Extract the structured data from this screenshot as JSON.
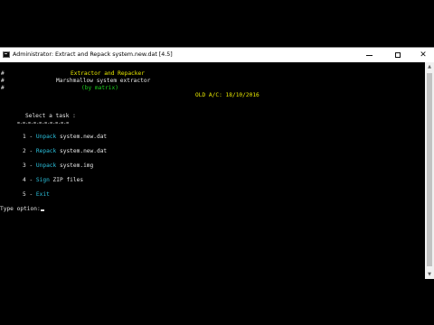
{
  "window": {
    "title": "Administrator:  Extract and Repack system.new.dat [4.5]",
    "icon": "cmd-icon"
  },
  "header": {
    "hash1": "#",
    "hash2": "#",
    "hash3": "#",
    "line1": "Extractor and Repacker",
    "line2": "Marshmallow system extractor",
    "line3": "(by matrix)",
    "old_ac": "OLD A/C: 18/10/2016"
  },
  "menu": {
    "heading": "Select a task :",
    "divider": "=-=-=-=-=-=-=-=-=-=",
    "items": [
      {
        "num": "1 - ",
        "action": "Unpack",
        "target": " system.new.dat"
      },
      {
        "num": "2 - ",
        "action": "Repack",
        "target": " system.new.dat"
      },
      {
        "num": "3 - ",
        "action": "Unpack",
        "target": " system.img"
      },
      {
        "num": "4 - ",
        "action": "Sign",
        "target": " ZIP files"
      },
      {
        "num": "5 - ",
        "action": "Exit",
        "target": ""
      }
    ]
  },
  "prompt": {
    "label": "Type option:"
  },
  "colors": {
    "background": "#000000",
    "action": "#2bc0dc",
    "header_title": "#e8e800",
    "credit": "#1ed21e"
  }
}
